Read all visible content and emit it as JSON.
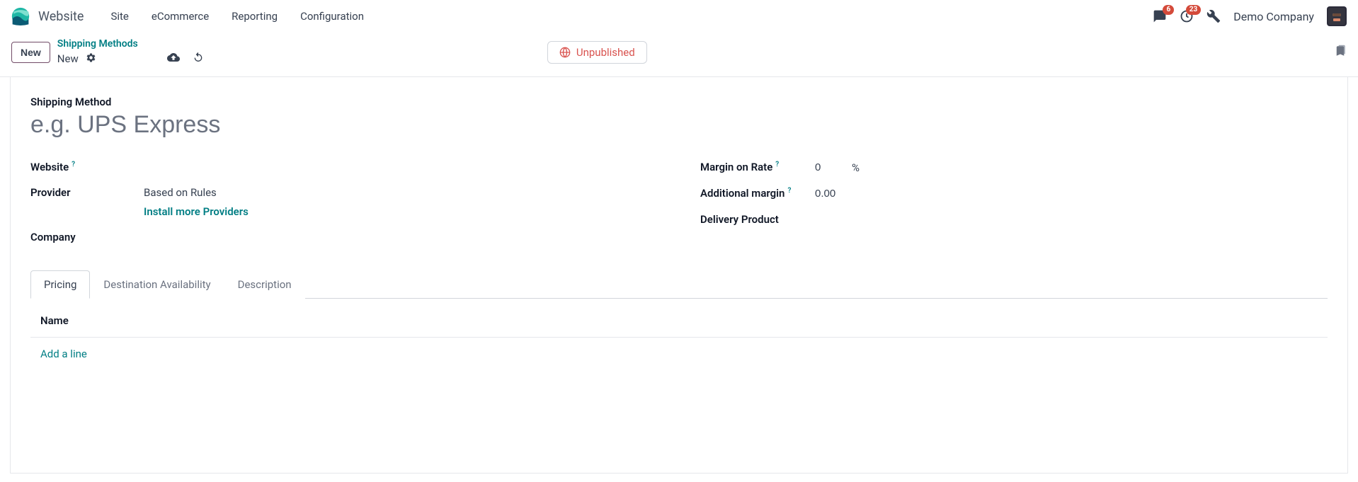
{
  "navbar": {
    "app_name": "Website",
    "menu": [
      "Site",
      "eCommerce",
      "Reporting",
      "Configuration"
    ],
    "messages_badge": "6",
    "activities_badge": "23",
    "company": "Demo Company"
  },
  "actionbar": {
    "new_label": "New",
    "breadcrumb_parent": "Shipping Methods",
    "breadcrumb_current": "New",
    "unpublished_label": "Unpublished"
  },
  "form": {
    "title_label": "Shipping Method",
    "title_placeholder": "e.g. UPS Express",
    "left": {
      "website_label": "Website",
      "provider_label": "Provider",
      "provider_value": "Based on Rules",
      "install_more": "Install more Providers",
      "company_label": "Company"
    },
    "right": {
      "margin_rate_label": "Margin on Rate",
      "margin_rate_value": "0",
      "margin_rate_unit": "%",
      "additional_margin_label": "Additional margin",
      "additional_margin_value": "0.00",
      "delivery_product_label": "Delivery Product"
    },
    "tabs": {
      "pricing": "Pricing",
      "destination": "Destination Availability",
      "description": "Description"
    },
    "pricing_tab": {
      "name_header": "Name",
      "add_line": "Add a line"
    }
  }
}
